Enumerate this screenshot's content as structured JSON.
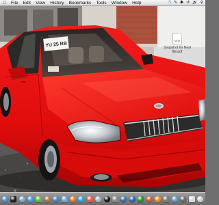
{
  "menubar": {
    "apple": "",
    "items": [
      "File",
      "Edit",
      "View",
      "History",
      "Bookmarks",
      "Tools",
      "Window",
      "Help"
    ]
  },
  "desktop": {
    "file_label": "NEW",
    "file_name_line1": "Snapshot for Neal",
    "file_name_line2": "file.pdf"
  },
  "dock": {
    "icons": [
      {
        "name": "finder-icon",
        "color": "#4a8fd8"
      },
      {
        "name": "dashboard-icon",
        "color": "#222222"
      },
      {
        "name": "mail-icon",
        "color": "#7fa9d0"
      },
      {
        "name": "safari-icon",
        "color": "#3c9fe6"
      },
      {
        "name": "ichat-icon",
        "color": "#5fb84a"
      },
      {
        "name": "address-book-icon",
        "color": "#b8743a"
      },
      {
        "name": "itunes-icon",
        "color": "#3f86d6"
      },
      {
        "name": "iphoto-icon",
        "color": "#6aa4d2"
      },
      {
        "name": "firefox-icon",
        "color": "#e67b2c"
      },
      {
        "name": "skype-icon",
        "color": "#27a8e0"
      },
      {
        "name": "calendar-icon",
        "color": "#e25b4f"
      },
      {
        "name": "preview-icon",
        "color": "#9fb5c9"
      },
      {
        "name": "terminal-icon",
        "color": "#1a1a1a"
      },
      {
        "name": "system-preferences-icon",
        "color": "#8a8a8a"
      },
      {
        "name": "photoshop-icon",
        "color": "#2d6fb5"
      },
      {
        "name": "word-icon",
        "color": "#2f5fb3"
      },
      {
        "name": "excel-icon",
        "color": "#2e8b3c"
      },
      {
        "name": "powerpoint-icon",
        "color": "#d2572d"
      },
      {
        "name": "vlc-icon",
        "color": "#f08a18"
      },
      {
        "name": "utilities-icon",
        "color": "#7c7c7c"
      },
      {
        "name": "app-store-icon",
        "color": "#5a9fd0"
      },
      {
        "name": "downloads-stack-icon",
        "color": "#6a6a6a"
      },
      {
        "name": "documents-stack-icon",
        "color": "#d8d8d8"
      },
      {
        "name": "trash-icon",
        "color": "#cfcfcf"
      }
    ]
  },
  "wallpaper": {
    "license_plate": "YU 25 RB"
  }
}
